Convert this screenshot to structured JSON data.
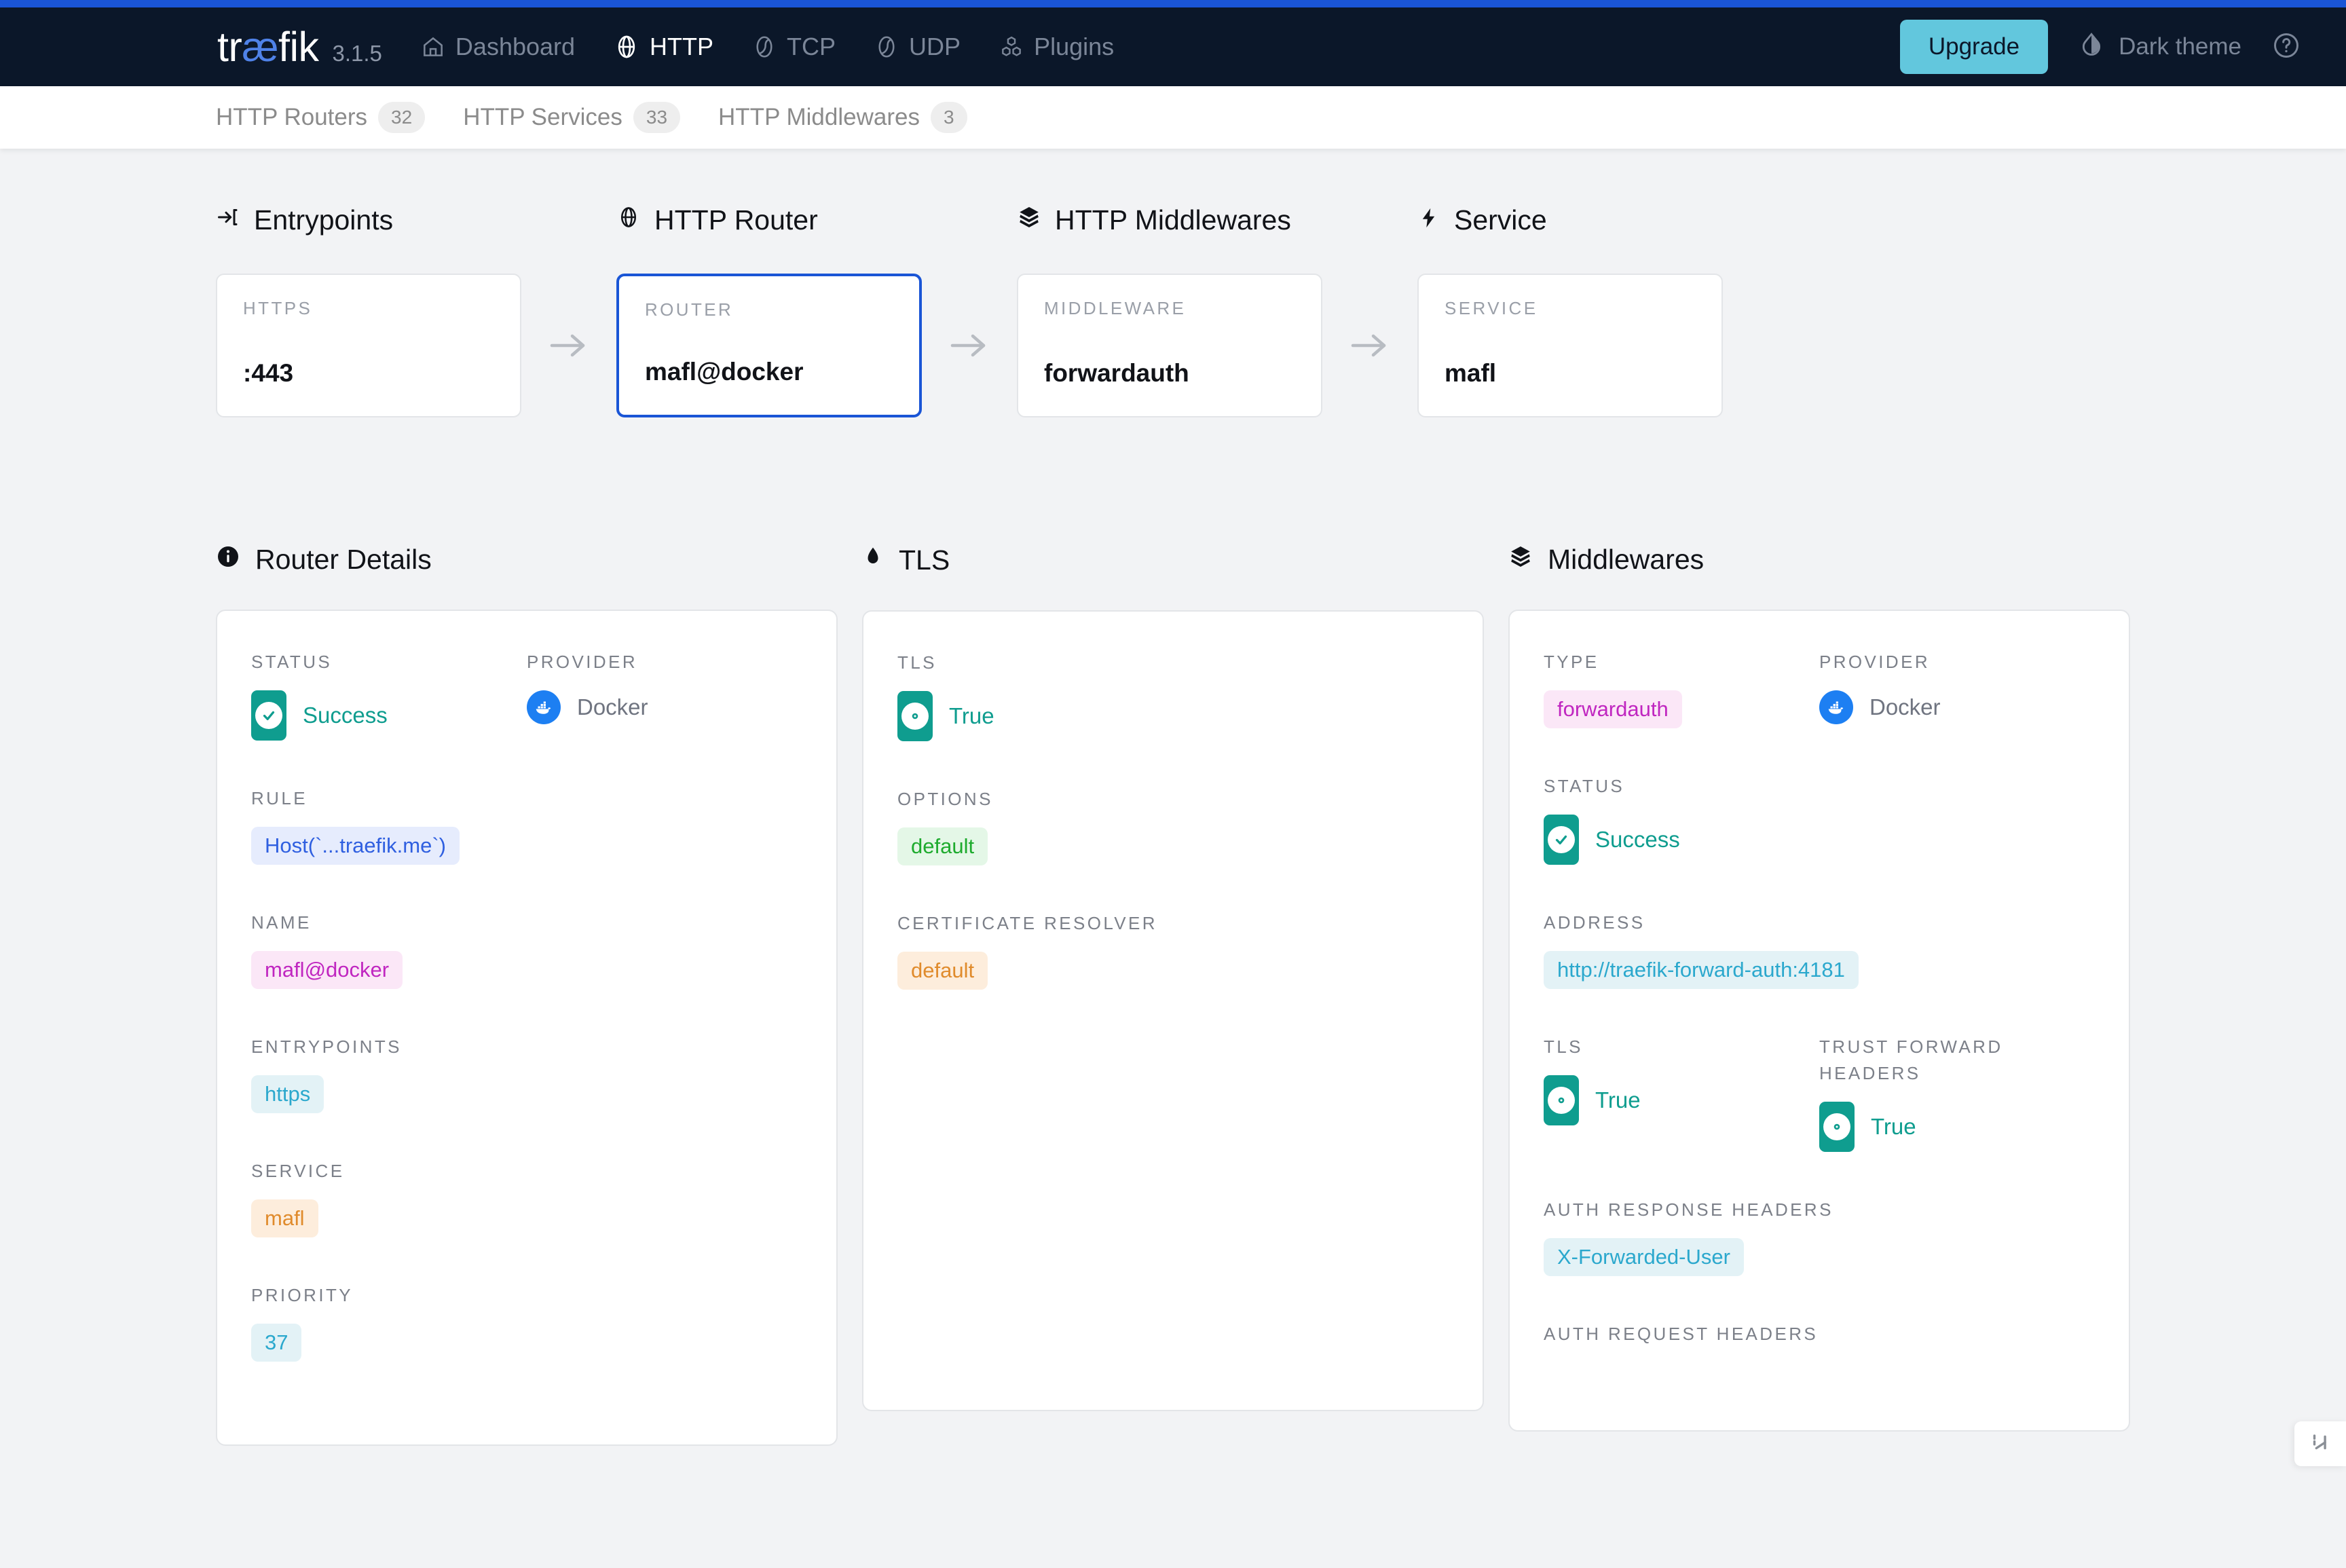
{
  "brand": {
    "name_part1": "tr",
    "name_ae": "æ",
    "name_part2": "fik",
    "version": "3.1.5"
  },
  "nav": {
    "links": [
      {
        "label": "Dashboard",
        "icon": "home-icon",
        "active": false
      },
      {
        "label": "HTTP",
        "icon": "globe-icon",
        "active": true
      },
      {
        "label": "TCP",
        "icon": "tcp-icon",
        "active": false
      },
      {
        "label": "UDP",
        "icon": "udp-icon",
        "active": false
      },
      {
        "label": "Plugins",
        "icon": "plugins-icon",
        "active": false
      }
    ],
    "upgrade_label": "Upgrade",
    "theme_label": "Dark theme",
    "help_icon": "help-circle-icon",
    "accent_color": "#1a55d6",
    "upgrade_color": "#62c7dd",
    "navbar_color": "#0b1729"
  },
  "tabs": [
    {
      "label": "HTTP Routers",
      "count": "32"
    },
    {
      "label": "HTTP Services",
      "count": "33"
    },
    {
      "label": "HTTP Middlewares",
      "count": "3"
    }
  ],
  "flow": {
    "entrypoints": {
      "heading": "Entrypoints",
      "icon": "login-arrow-icon",
      "card_label": "HTTPS",
      "card_value": ":443"
    },
    "router": {
      "heading": "HTTP Router",
      "icon": "globe-icon",
      "card_label": "ROUTER",
      "card_value": "mafl@docker",
      "selected": true,
      "selected_color": "#1a55d6"
    },
    "middlewares": {
      "heading": "HTTP Middlewares",
      "icon": "layers-icon",
      "card_label": "MIDDLEWARE",
      "card_value": "forwardauth"
    },
    "service": {
      "heading": "Service",
      "icon": "bolt-icon",
      "card_label": "SERVICE",
      "card_value": "mafl"
    }
  },
  "router_details": {
    "heading": "Router Details",
    "icon": "info-icon",
    "status_label": "STATUS",
    "status_value": "Success",
    "status_color": "#0f9d8f",
    "provider_label": "PROVIDER",
    "provider_value": "Docker",
    "provider_icon": "docker-icon",
    "rule_label": "RULE",
    "rule_value": "Host(`...traefik.me`)",
    "name_label": "NAME",
    "name_value": "mafl@docker",
    "entrypoints_label": "ENTRYPOINTS",
    "entrypoints_value": "https",
    "service_label": "SERVICE",
    "service_value": "mafl",
    "priority_label": "PRIORITY",
    "priority_value": "37"
  },
  "tls": {
    "heading": "TLS",
    "icon": "shield-icon",
    "tls_label": "TLS",
    "tls_value": "True",
    "options_label": "OPTIONS",
    "options_value": "default",
    "cert_resolver_label": "CERTIFICATE RESOLVER",
    "cert_resolver_value": "default"
  },
  "middlewares": {
    "heading": "Middlewares",
    "icon": "layers-icon",
    "type_label": "TYPE",
    "type_value": "forwardauth",
    "provider_label": "PROVIDER",
    "provider_value": "Docker",
    "provider_icon": "docker-icon",
    "status_label": "STATUS",
    "status_value": "Success",
    "address_label": "ADDRESS",
    "address_value": "http://traefik-forward-auth:4181",
    "tls_label": "TLS",
    "tls_value": "True",
    "trust_forward_headers_label": "TRUST FORWARD HEADERS",
    "trust_forward_headers_value": "True",
    "auth_response_headers_label": "AUTH RESPONSE HEADERS",
    "auth_response_headers_value": "X-Forwarded-User",
    "auth_request_headers_label": "AUTH REQUEST HEADERS"
  },
  "float_widget": {
    "icon": "resize-handle-icon"
  }
}
